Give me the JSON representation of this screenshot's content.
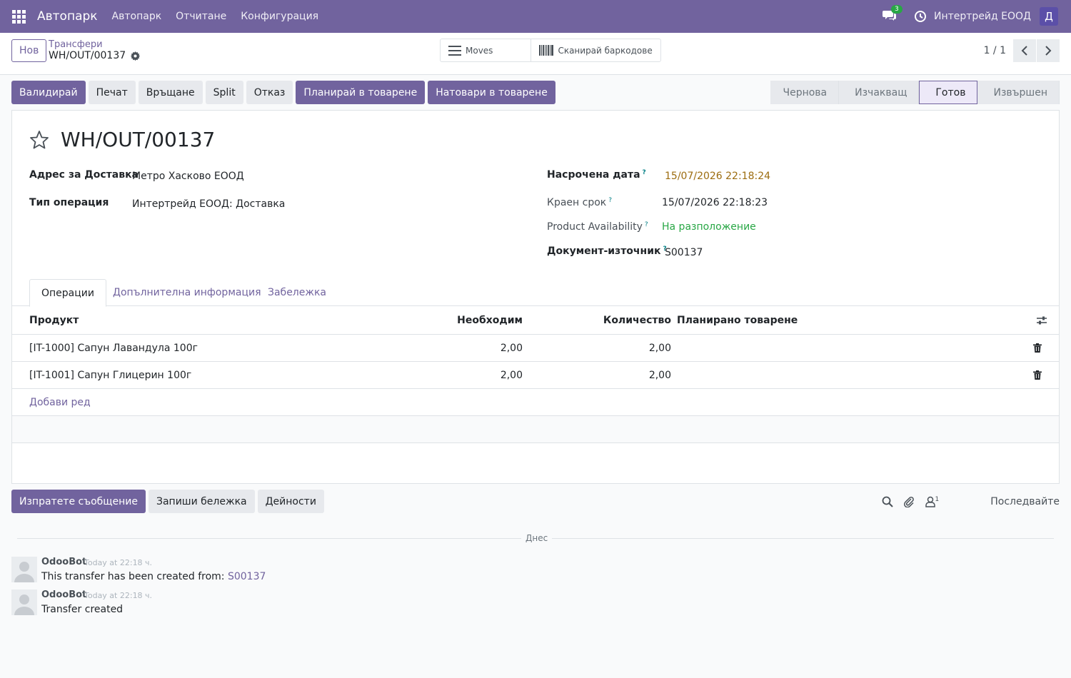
{
  "navbar": {
    "app_name": "Автопарк",
    "menu": [
      "Автопарк",
      "Отчитане",
      "Конфигурация"
    ],
    "messages_count": "3",
    "company": "Интертрейд ЕООД",
    "user_initial": "Д",
    "accent_color": "#71639e"
  },
  "control_panel": {
    "new_label": "Нов",
    "breadcrumb_parent": "Трансфери",
    "breadcrumb_current": "WH/OUT/00137",
    "moves_label": "Moves",
    "scan_label": "Сканирай баркодове",
    "pager": "1 / 1"
  },
  "actions": {
    "validate": "Валидирай",
    "print": "Печат",
    "return": "Връщане",
    "split": "Split",
    "cancel": "Отказ",
    "plan_loading": "Планирай в товарене",
    "load": "Натовари в товарене"
  },
  "stages": [
    "Чернова",
    "Изчакващ",
    "Готов",
    "Извършен"
  ],
  "active_stage": "Готов",
  "form": {
    "title": "WH/OUT/00137",
    "delivery_address_label": "Адрес за Доставка",
    "delivery_address": "Метро Хасково ЕООД",
    "operation_type_label": "Тип операция",
    "operation_type": "Интертрейд ЕООД: Доставка",
    "scheduled_date_label": "Насрочена дата",
    "scheduled_date": "15/07/2026 22:18:24",
    "deadline_label": "Краен срок",
    "deadline": "15/07/2026 22:18:23",
    "availability_label": "Product Availability",
    "availability": "На разположение",
    "source_doc_label": "Документ-източник",
    "source_doc": "S00137",
    "help_mark": "?"
  },
  "tabs": [
    "Операции",
    "Допълнителна информация",
    "Забележка"
  ],
  "table": {
    "headers": {
      "product": "Продукт",
      "needed": "Необходим",
      "quantity": "Количество",
      "planned_loading": "Планирано товарене"
    },
    "rows": [
      {
        "product": "[IT-1000] Сапун Лавандула 100г",
        "needed": "2,00",
        "quantity": "2,00"
      },
      {
        "product": "[IT-1001] Сапун Глицерин 100г",
        "needed": "2,00",
        "quantity": "2,00"
      }
    ],
    "add_line": "Добави ред"
  },
  "chatter": {
    "send_message": "Изпратете съобщение",
    "log_note": "Запиши бележка",
    "activities": "Дейности",
    "followers_count": "1",
    "follow": "Последвайте",
    "divider": "Днес",
    "messages": [
      {
        "author": "OdooBot",
        "date": "Today at 22:18 ч.",
        "body": "This transfer has been created from: ",
        "link": "S00137"
      },
      {
        "author": "OdooBot",
        "date": "Today at 22:18 ч.",
        "body": "Transfer created",
        "link": ""
      }
    ]
  }
}
